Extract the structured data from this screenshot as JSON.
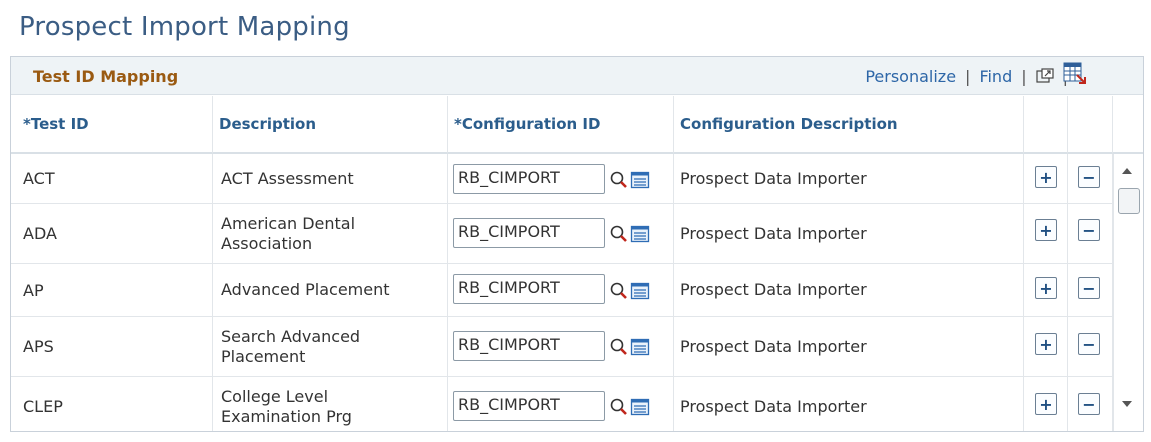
{
  "page": {
    "title": "Prospect Import Mapping"
  },
  "grid": {
    "title": "Test ID Mapping",
    "nav": {
      "personalize": "Personalize",
      "find": "Find",
      "separator": "|"
    },
    "columns": [
      {
        "label": "*Test ID"
      },
      {
        "label": "Description"
      },
      {
        "label": "*Configuration ID"
      },
      {
        "label": "Configuration Description"
      }
    ],
    "rows": [
      {
        "test_id": "ACT",
        "description": "ACT Assessment",
        "config_id": "RB_CIMPORT",
        "config_desc": "Prospect Data Importer"
      },
      {
        "test_id": "ADA",
        "description": "American Dental Association",
        "config_id": "RB_CIMPORT",
        "config_desc": "Prospect Data Importer"
      },
      {
        "test_id": "AP",
        "description": "Advanced Placement",
        "config_id": "RB_CIMPORT",
        "config_desc": "Prospect Data Importer"
      },
      {
        "test_id": "APS",
        "description": "Search Advanced Placement",
        "config_id": "RB_CIMPORT",
        "config_desc": "Prospect Data Importer"
      },
      {
        "test_id": "CLEP",
        "description": "College Level Examination Prg",
        "config_id": "RB_CIMPORT",
        "config_desc": "Prospect Data Importer"
      }
    ],
    "add_symbol": "+",
    "remove_symbol": "−"
  },
  "colors": {
    "title": "#3b5d84",
    "grid_title": "#9a5a12",
    "link": "#2d66a7",
    "header": "#2b5d8c"
  },
  "icons": {
    "zoom": "new-window-icon",
    "download": "download-to-excel-icon",
    "prompt": "search-icon",
    "detail": "detail-view-icon"
  }
}
